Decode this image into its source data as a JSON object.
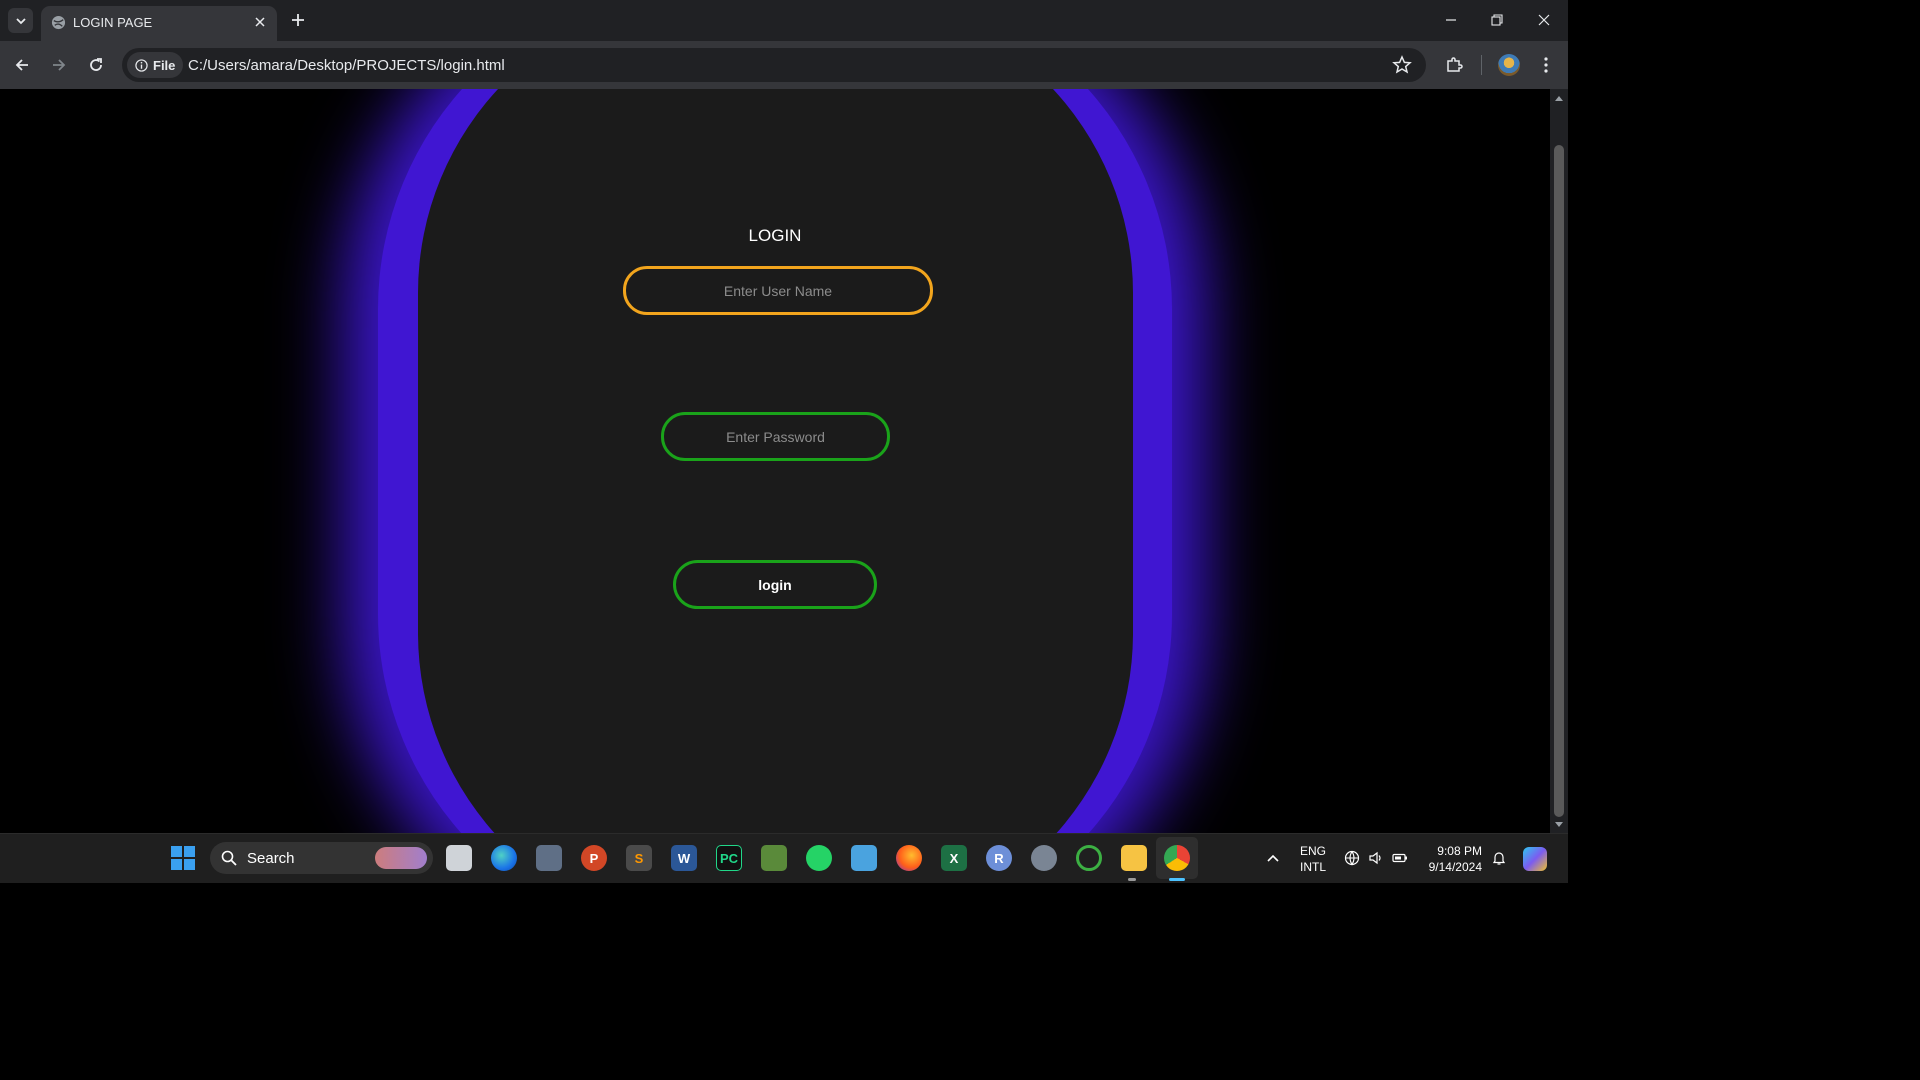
{
  "browser": {
    "tab_title": "LOGIN PAGE",
    "site_chip": "File",
    "url": "C:/Users/amara/Desktop/PROJECTS/login.html"
  },
  "page": {
    "heading": "LOGIN",
    "username_placeholder": "Enter User Name",
    "password_placeholder": "Enter Password",
    "login_button": "login",
    "colors": {
      "glow": "#3b16c8",
      "card": "#1b1b1b",
      "username_border": "#f2a51d",
      "password_border": "#1aa31a",
      "button_border": "#1aa31a"
    }
  },
  "taskbar": {
    "search_label": "Search",
    "apps": [
      "task-view-icon",
      "edge-icon",
      "calculator-icon",
      "powerpoint-icon",
      "sublime-icon",
      "word-icon",
      "pycharm-icon",
      "image-app-icon",
      "whatsapp-icon",
      "notepad-icon",
      "firefox-icon",
      "excel-icon",
      "r-icon",
      "settings-icon",
      "refresh-app-icon",
      "file-explorer-icon",
      "chrome-icon"
    ],
    "lang_top": "ENG",
    "lang_bottom": "INTL",
    "time": "9:08 PM",
    "date": "9/14/2024"
  }
}
